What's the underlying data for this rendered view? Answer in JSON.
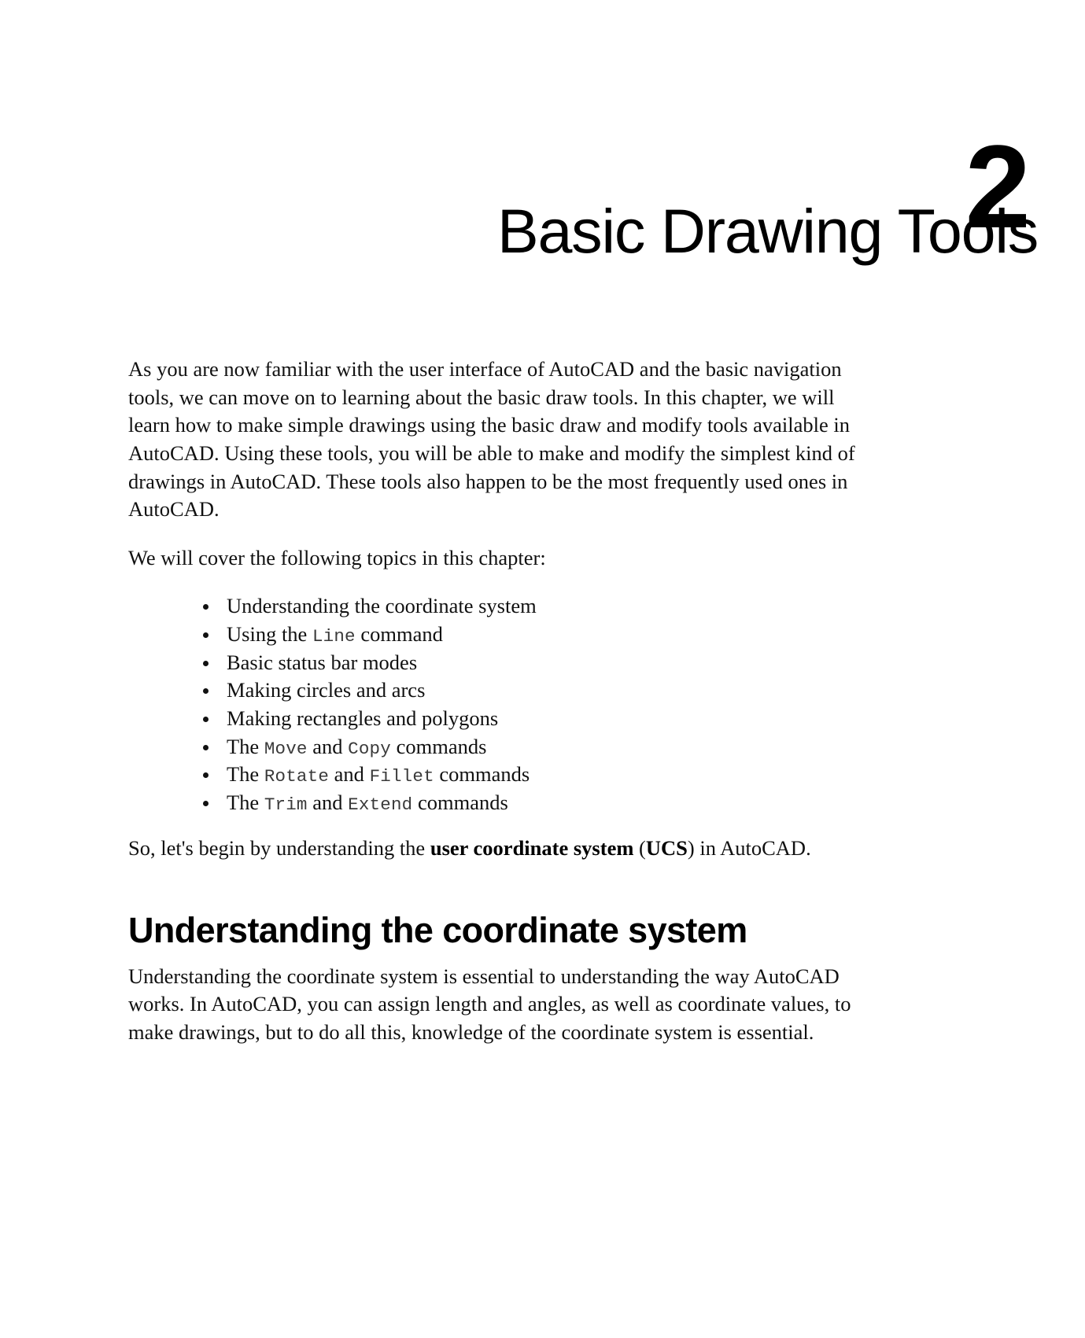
{
  "page": {
    "background_color": "#ffffff",
    "text_color": "#111111"
  },
  "chapter": {
    "number": "2",
    "title": "Basic Drawing Tools"
  },
  "intro": {
    "paragraph": "As you are now familiar with the user interface of AutoCAD and the basic navigation tools, we can move on to learning about the basic draw tools. In this chapter, we will learn how to make simple drawings using the basic draw and modify tools available in AutoCAD. Using these tools, you will be able to make and modify the simplest kind of drawings in AutoCAD. These tools also happen to be the most frequently used ones in AutoCAD."
  },
  "topics": {
    "lead_in": "We will cover the following topics in this chapter:",
    "items": [
      {
        "prefix": "Understanding the coordinate system",
        "code1": "",
        "middle": "",
        "code2": "",
        "suffix": ""
      },
      {
        "prefix": "Using the ",
        "code1": "Line",
        "middle": "",
        "code2": "",
        "suffix": " command"
      },
      {
        "prefix": "Basic status bar modes",
        "code1": "",
        "middle": "",
        "code2": "",
        "suffix": ""
      },
      {
        "prefix": "Making circles and arcs",
        "code1": "",
        "middle": "",
        "code2": "",
        "suffix": ""
      },
      {
        "prefix": "Making rectangles and polygons",
        "code1": "",
        "middle": "",
        "code2": "",
        "suffix": ""
      },
      {
        "prefix": "The ",
        "code1": "Move",
        "middle": " and ",
        "code2": "Copy",
        "suffix": " commands"
      },
      {
        "prefix": "The ",
        "code1": "Rotate",
        "middle": " and ",
        "code2": "Fillet",
        "suffix": " commands"
      },
      {
        "prefix": "The ",
        "code1": "Trim",
        "middle": " and ",
        "code2": "Extend",
        "suffix": " commands"
      }
    ]
  },
  "closing": {
    "before_bold": "So, let's begin by understanding the ",
    "bold_term": "user coordinate system",
    "middle": " (",
    "bold_acronym": "UCS",
    "after_bold": ") in AutoCAD."
  },
  "section": {
    "heading": "Understanding the coordinate system",
    "paragraph": "Understanding the coordinate system is essential to understanding the way AutoCAD works. In AutoCAD, you can assign length and angles, as well as coordinate values, to make drawings, but to do all this, knowledge of the coordinate system is essential."
  }
}
